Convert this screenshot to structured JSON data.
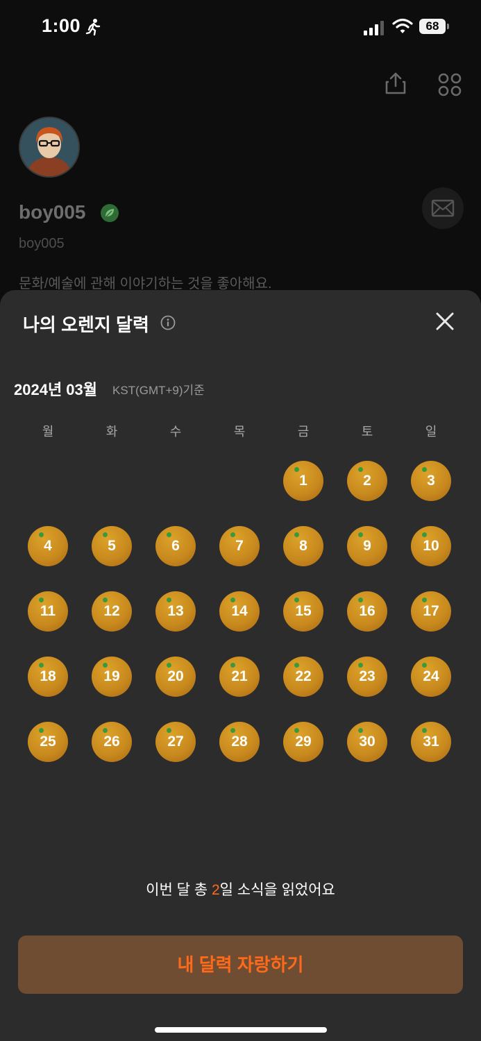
{
  "status_bar": {
    "time": "1:00",
    "battery": "68"
  },
  "profile": {
    "username": "boy005",
    "handle": "boy005",
    "bio": "문화/예술에 관해 이야기하는 것을 좋아해요."
  },
  "sheet": {
    "title": "나의 오렌지 달력",
    "month": "2024년 03월",
    "timezone": "KST(GMT+9)기준",
    "weekdays": [
      "월",
      "화",
      "수",
      "목",
      "금",
      "토",
      "일"
    ],
    "days": [
      "1",
      "2",
      "3",
      "4",
      "5",
      "6",
      "7",
      "8",
      "9",
      "10",
      "11",
      "12",
      "13",
      "14",
      "15",
      "16",
      "17",
      "18",
      "19",
      "20",
      "21",
      "22",
      "23",
      "24",
      "25",
      "26",
      "27",
      "28",
      "29",
      "30",
      "31"
    ],
    "summary_prefix": "이번 달 총 ",
    "summary_count": "2",
    "summary_suffix": "일 소식을 읽었어요",
    "cta_label": "내 달력 자랑하기"
  },
  "colors": {
    "accent": "#ff6a1a",
    "orange": "#d4961f",
    "sheet_bg": "#2c2c2c",
    "cta_bg": "#6e4d33"
  },
  "icons": [
    "running-icon",
    "signal-icon",
    "wifi-icon",
    "share-icon",
    "grid-menu-icon",
    "verified-leaf-icon",
    "mail-icon",
    "info-icon",
    "close-icon"
  ]
}
